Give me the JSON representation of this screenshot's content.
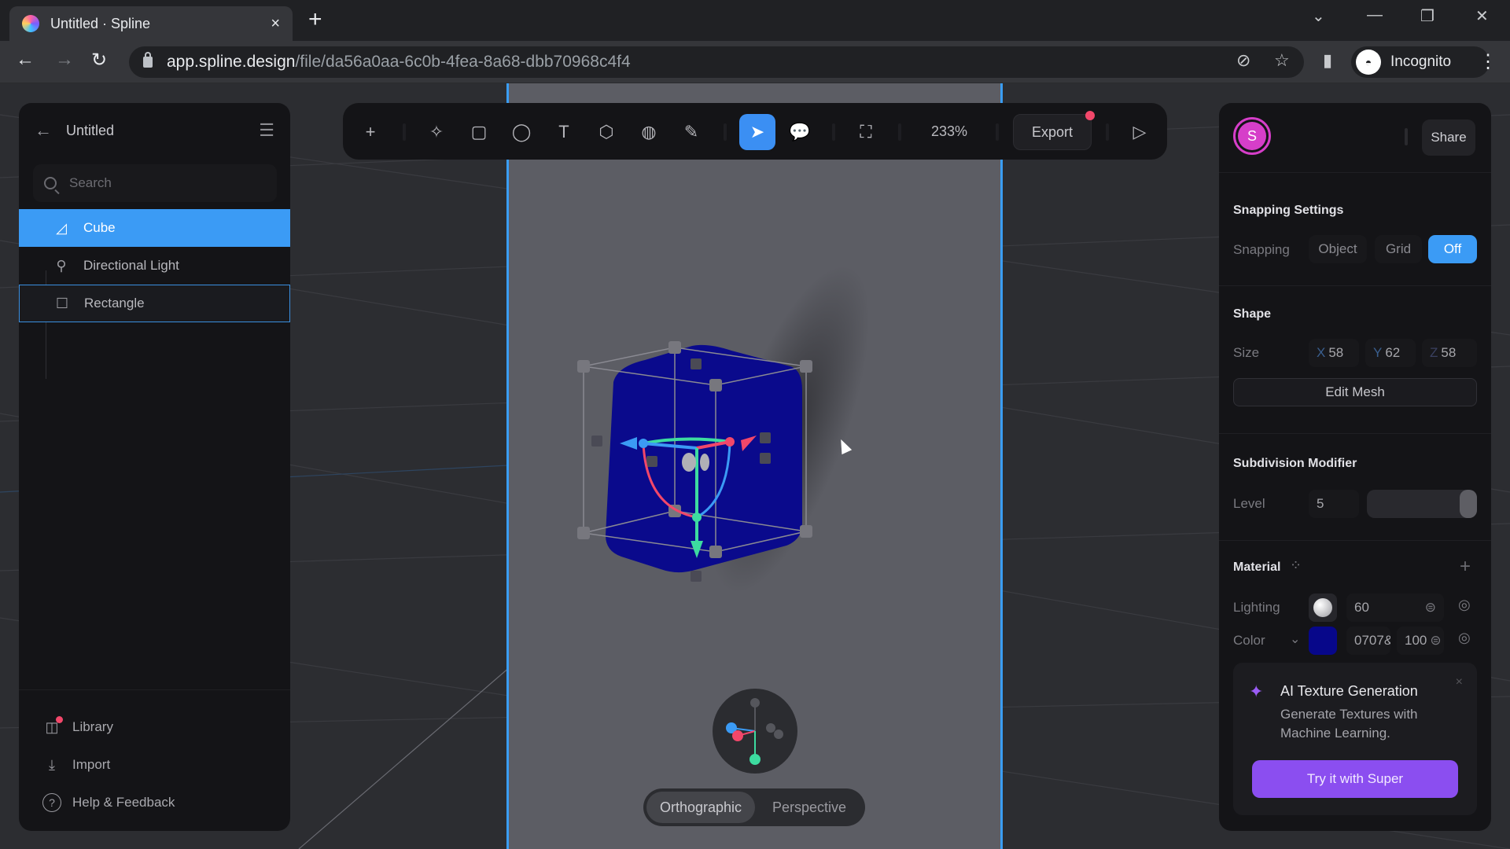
{
  "browser": {
    "tab_title": "Untitled · Spline",
    "url_host": "app.spline.design",
    "url_path": "/file/da56a0aa-6c0b-4fea-8a68-dbb70968c4f4",
    "profile_label": "Incognito",
    "icons": {
      "tab_close": "×",
      "new_tab": "+",
      "back": "←",
      "forward": "→",
      "reload": "↻",
      "tab_search": "⌄",
      "minimize": "—",
      "restore": "❐",
      "close": "✕",
      "eye_off": "⊘",
      "bookmark": "☆",
      "side_panel": "▮",
      "menu": "⋮"
    }
  },
  "left_panel": {
    "back_icon": "←",
    "file_name": "Untitled",
    "menu_icon": "☰",
    "search_placeholder": "Search",
    "layers": [
      {
        "label": "Cube",
        "icon": "◿",
        "state": "selected"
      },
      {
        "label": "Directional Light",
        "icon": "⚲",
        "state": "normal"
      },
      {
        "label": "Rectangle",
        "icon": "☐",
        "state": "hovered"
      }
    ],
    "footer": [
      {
        "label": "Library",
        "icon": "◫",
        "badge": true
      },
      {
        "label": "Import",
        "icon": "⤓",
        "badge": false
      },
      {
        "label": "Help & Feedback",
        "icon": "?",
        "badge": false
      }
    ]
  },
  "toolbar": {
    "tools": [
      {
        "name": "add",
        "icon": "+"
      },
      {
        "name": "ai-generate",
        "icon": "✧"
      },
      {
        "name": "rectangle",
        "icon": "▢"
      },
      {
        "name": "ellipse",
        "icon": "◯"
      },
      {
        "name": "text",
        "icon": "T"
      },
      {
        "name": "cube",
        "icon": "⬡"
      },
      {
        "name": "sphere",
        "icon": "◍"
      },
      {
        "name": "pen",
        "icon": "✎"
      },
      {
        "name": "select",
        "icon": "➤"
      },
      {
        "name": "comment",
        "icon": "💬"
      },
      {
        "name": "frame",
        "icon": "⛶"
      },
      {
        "name": "play",
        "icon": "▷"
      }
    ],
    "zoom": "233%",
    "export_label": "Export"
  },
  "right_panel": {
    "avatar_initial": "S",
    "share_label": "Share",
    "snapping": {
      "title": "Snapping Settings",
      "row_label": "Snapping",
      "options": [
        "Object",
        "Grid",
        "Off"
      ],
      "selected": "Off"
    },
    "shape": {
      "title": "Shape",
      "size_label": "Size",
      "x_label": "X",
      "x": "58",
      "y_label": "Y",
      "y": "62",
      "z_label": "Z",
      "z": "58",
      "edit_mesh_label": "Edit Mesh"
    },
    "subdivision": {
      "title": "Subdivision Modifier",
      "level_label": "Level",
      "level": "5",
      "slider_fraction": 1.0
    },
    "material": {
      "title": "Material",
      "add_icon": "+",
      "grid_icon": "⁘",
      "lighting_label": "Lighting",
      "lighting_value": "60",
      "color_label": "Color",
      "color_hex_display": "0707&",
      "color_swatch": "#07078a",
      "opacity": "100",
      "eye_icon": "◎"
    },
    "ai_card": {
      "title": "AI Texture Generation",
      "description": "Generate Textures with Machine Learning.",
      "cta": "Try it with Super",
      "close_icon": "×",
      "sparkle_icon": "✦"
    }
  },
  "viewport": {
    "view_modes": [
      "Orthographic",
      "Perspective"
    ],
    "active_view": "Orthographic",
    "colors": {
      "accent": "#3b9bf5",
      "cube": "#0a0a8c",
      "axis_x": "#f2476a",
      "axis_y": "#3ddba0",
      "axis_z": "#3b9bf5",
      "ai_purple": "#8b4ef0",
      "avatar": "#d63ec9"
    }
  }
}
